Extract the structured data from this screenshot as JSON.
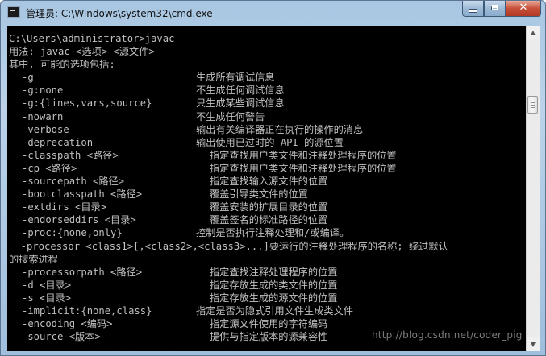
{
  "window": {
    "title": "管理员: C:\\Windows\\system32\\cmd.exe",
    "app_icon": "cmd-icon",
    "minimize_icon": "minimize-icon",
    "maximize_icon": "maximize-icon",
    "close_icon": "close-icon",
    "close_glyph": "✕"
  },
  "console": {
    "prompt_line": "C:\\Users\\administrator>javac",
    "usage_line": "用法: javac <选项> <源文件>",
    "intro_line": "其中, 可能的选项包括:",
    "options": [
      {
        "opt": "-g",
        "desc": "生成所有调试信息"
      },
      {
        "opt": "-g:none",
        "desc": "不生成任何调试信息"
      },
      {
        "opt": "-g:{lines,vars,source}",
        "desc": "只生成某些调试信息"
      },
      {
        "opt": "-nowarn",
        "desc": "不生成任何警告"
      },
      {
        "opt": "-verbose",
        "desc": "输出有关编译器正在执行的操作的消息"
      },
      {
        "opt": "-deprecation",
        "desc": "输出使用已过时的 API 的源位置"
      },
      {
        "opt": "-classpath <路径>",
        "desc": "指定查找用户类文件和注释处理程序的位置"
      },
      {
        "opt": "-cp <路径>",
        "desc": "指定查找用户类文件和注释处理程序的位置"
      },
      {
        "opt": "-sourcepath <路径>",
        "desc": "指定查找输入源文件的位置"
      },
      {
        "opt": "-bootclasspath <路径>",
        "desc": "覆盖引导类文件的位置"
      },
      {
        "opt": "-extdirs <目录>",
        "desc": "覆盖安装的扩展目录的位置"
      },
      {
        "opt": "-endorseddirs <目录>",
        "desc": "覆盖签名的标准路径的位置"
      },
      {
        "opt": "-proc:{none,only}",
        "desc": "控制是否执行注释处理和/或编译。"
      }
    ],
    "processor_line": "  -processor <class1>[,<class2>,<class3>...]要运行的注释处理程序的名称; 绕过默认",
    "processor_wrap": "的搜索进程",
    "options_after": [
      {
        "opt": "-processorpath <路径>",
        "desc": "指定查找注释处理程序的位置"
      },
      {
        "opt": "-d <目录>",
        "desc": "指定存放生成的类文件的位置"
      },
      {
        "opt": "-s <目录>",
        "desc": "指定存放生成的源文件的位置"
      },
      {
        "opt": "-implicit:{none,class}",
        "desc": "指定是否为隐式引用文件生成类文件"
      },
      {
        "opt": "-encoding <编码>",
        "desc": "指定源文件使用的字符编码"
      },
      {
        "opt": "-source <版本>",
        "desc": "提供与指定版本的源兼容性"
      }
    ],
    "watermark": "http://blog.csdn.net/coder_pig"
  },
  "scrollbar": {
    "up_icon": "scroll-up-arrow-icon",
    "up_glyph": "▲",
    "down_icon": "scroll-down-arrow-icon",
    "down_glyph": "▼",
    "thumb_position": 0.2
  },
  "colors": {
    "console_background": "#000000",
    "console_text": "#c0c0c0",
    "titlebar": "#bcd3e9",
    "close_button": "#c7503a"
  }
}
